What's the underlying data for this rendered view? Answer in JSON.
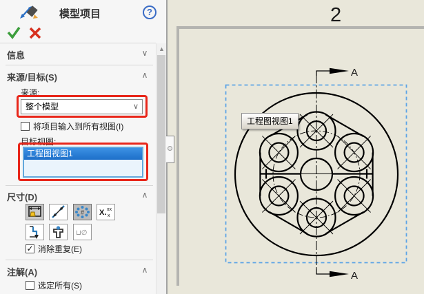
{
  "panel": {
    "title": "模型项目",
    "help_label": "?",
    "info_label": "信息",
    "source_target": {
      "label": "来源/目标(S)",
      "source_label": "来源:",
      "source_value": "整个模型",
      "import_all_label": "将项目输入到所有视图(I)",
      "target_views_label": "目标视图:",
      "target_view_items": [
        "工程图视图1"
      ]
    },
    "dimensions": {
      "label": "尺寸(D)",
      "icons": [
        "marked-for-drawing-icon",
        "not-marked-for-drawing-icon",
        "instance-count-icon",
        "tolerance-xxx-icon",
        "ordinate-dimension-icon",
        "hole-wizard-locations-icon",
        "hole-callout-icon"
      ],
      "eliminate_label": "消除重复(E)"
    },
    "annotations": {
      "label": "注解(A)",
      "select_all_label": "选定所有(S)"
    },
    "checks": {
      "import_all": "",
      "eliminate": "✓",
      "select_all": ""
    }
  },
  "canvas": {
    "zone_label": "2",
    "tooltip": "工程图视图1",
    "section_label_top": "A",
    "section_label_bottom": "A",
    "colors": {
      "sheet_bg": "#e9e7da",
      "sheet_border": "#b4b4b0",
      "selection_dash": "#5da4e6",
      "highlight_red": "#e8261a",
      "list_selection_blue": "#1d6fc9"
    }
  }
}
